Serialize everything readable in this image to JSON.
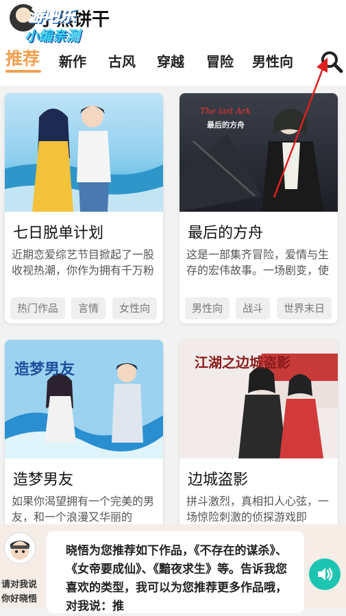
{
  "header": {
    "app_title": "小熊饼干",
    "watermark_line1": "游吧乐 ",
    "watermark_line2": "小编亲测"
  },
  "tabs": [
    {
      "label": "推荐",
      "active": true
    },
    {
      "label": "新作"
    },
    {
      "label": "古风"
    },
    {
      "label": "穿越"
    },
    {
      "label": "冒险"
    },
    {
      "label": "男性向"
    }
  ],
  "icons": {
    "search": "search-icon",
    "voice": "speaker-icon",
    "annotation_arrow": "red-arrow"
  },
  "colors": {
    "accent": "#f0a050",
    "arrow": "#e02020",
    "voice_button": "#1cc4b2",
    "panel_bg": "#f6ede6"
  },
  "cards": [
    {
      "title": "七日脱单计划",
      "desc": "近期恋爱综艺节目掀起了一股收视热潮，你作为拥有千万粉丝的人气美妆博主，...",
      "tags": [
        "热门作品",
        "言情",
        "女性向"
      ],
      "cover_text": ""
    },
    {
      "title": "最后的方舟",
      "desc": "这是一部集齐冒险，爱情与生存的宏伟故事。一场剧变，使地球的气温在短短...",
      "tags": [
        "男性向",
        "战斗",
        "世界末日"
      ],
      "cover_text_en": "The last Ark",
      "cover_text_cn": "最后的方舟"
    },
    {
      "title": "造梦男友",
      "desc": "如果你渴望拥有一个完美的男友，和一个浪漫又华丽的",
      "tags": [],
      "cover_text": "造梦男友"
    },
    {
      "title": "边城盗影",
      "desc": "拼斗激烈，真相扣人心弦，一场惊险刺激的侦探游戏即",
      "tags": [],
      "cover_text": "江湖之边城盗影"
    }
  ],
  "assistant": {
    "label": "请对我说你好晓悟",
    "message": "晓悟为您推荐如下作品，《不存在的谋杀》、《女帝要成仙》、《黯夜求生》等。告诉我您喜欢的类型，我可以为您推荐更多作品哦，对我说：推"
  }
}
